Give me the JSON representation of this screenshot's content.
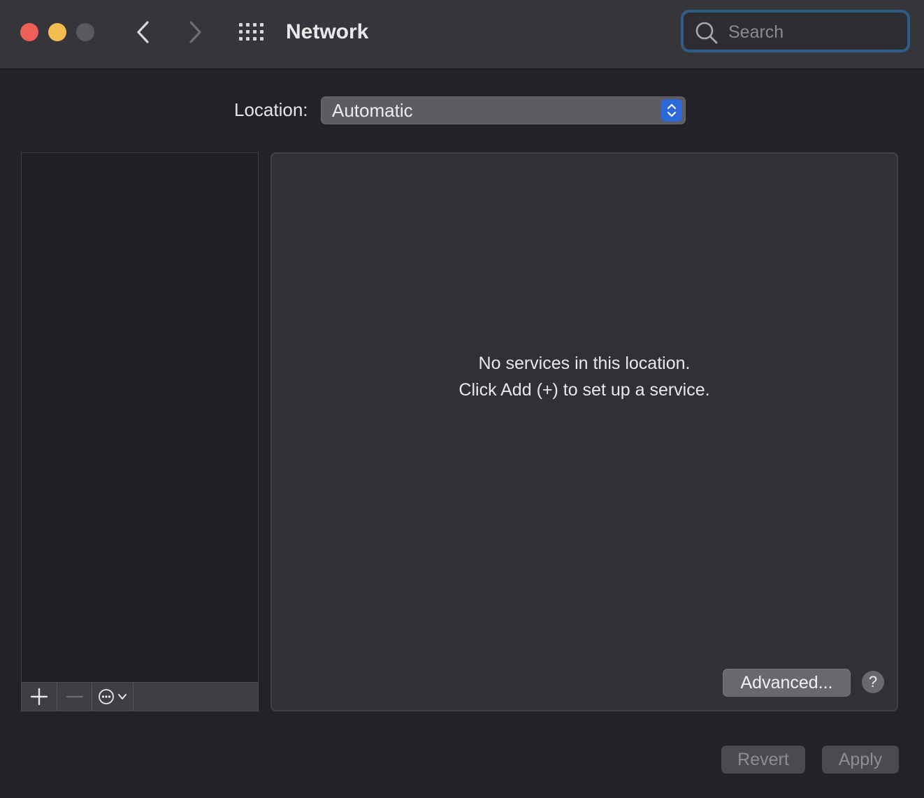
{
  "window": {
    "title": "Network"
  },
  "search": {
    "placeholder": "Search",
    "value": ""
  },
  "location": {
    "label": "Location:",
    "selected": "Automatic"
  },
  "detail": {
    "empty_line1": "No services in this location.",
    "empty_line2": "Click Add (+) to set up a service.",
    "advanced_label": "Advanced...",
    "help_label": "?"
  },
  "footer": {
    "revert_label": "Revert",
    "apply_label": "Apply"
  },
  "icons": {
    "back": "chevron-left-icon",
    "forward": "chevron-right-icon",
    "show_all": "grid-icon",
    "search": "search-icon",
    "add": "plus-icon",
    "remove": "minus-icon",
    "action": "ellipsis-circle-icon"
  },
  "colors": {
    "close": "#ed5f57",
    "minimize": "#f4bd4f",
    "zoom_disabled": "#5a595d",
    "accent": "#2d68d8",
    "search_focus_ring": "#2f5d8a"
  }
}
